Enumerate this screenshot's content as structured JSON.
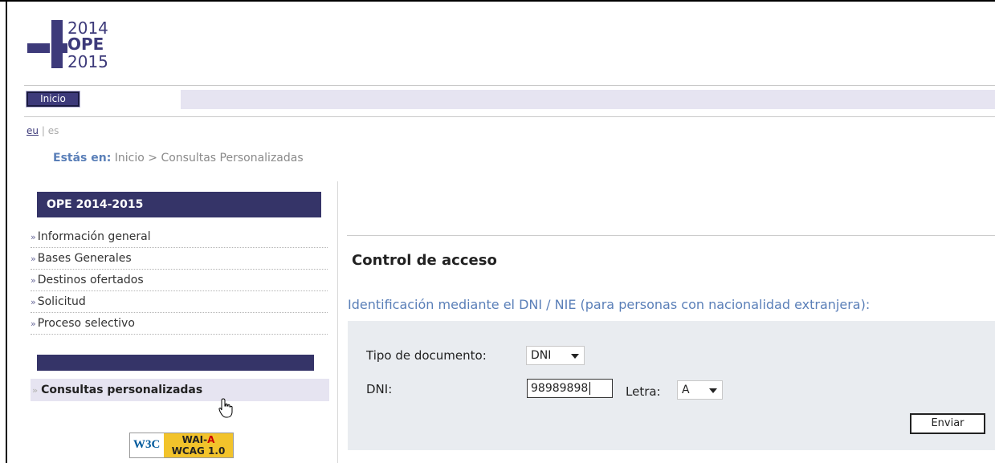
{
  "logo": {
    "line1": "2014",
    "line2": "OPE",
    "line3": "2015"
  },
  "nav": {
    "home_label": "Inicio"
  },
  "languages": {
    "eu": "eu",
    "separator": "|",
    "es": "es"
  },
  "breadcrumb": {
    "label": "Estás en:",
    "home": "Inicio",
    "separator": ">",
    "current": "Consultas Personalizadas"
  },
  "sidebar": {
    "title": "OPE 2014-2015",
    "items": [
      {
        "label": "Información general"
      },
      {
        "label": "Bases Generales"
      },
      {
        "label": "Destinos ofertados"
      },
      {
        "label": "Solicitud"
      },
      {
        "label": "Proceso selectivo"
      }
    ],
    "active_item": "Consultas personalizadas",
    "arrow": "»"
  },
  "badge": {
    "w3c": "W3C",
    "line1a": "WAI-",
    "line1b": "A",
    "line2": "WCAG 1.0"
  },
  "main": {
    "title": "Control de acceso",
    "subtitle": "Identificación mediante el DNI / NIE (para personas con nacionalidad extranjera):",
    "form": {
      "doc_type_label": "Tipo de documento:",
      "doc_type_value": "DNI",
      "dni_label": "DNI:",
      "dni_value": "98989898",
      "letter_label": "Letra:",
      "letter_value": "A",
      "submit_label": "Enviar"
    }
  },
  "colors": {
    "brand": "#3d3a7a",
    "link": "#5a7fb8",
    "panel": "#e9ecf0"
  }
}
